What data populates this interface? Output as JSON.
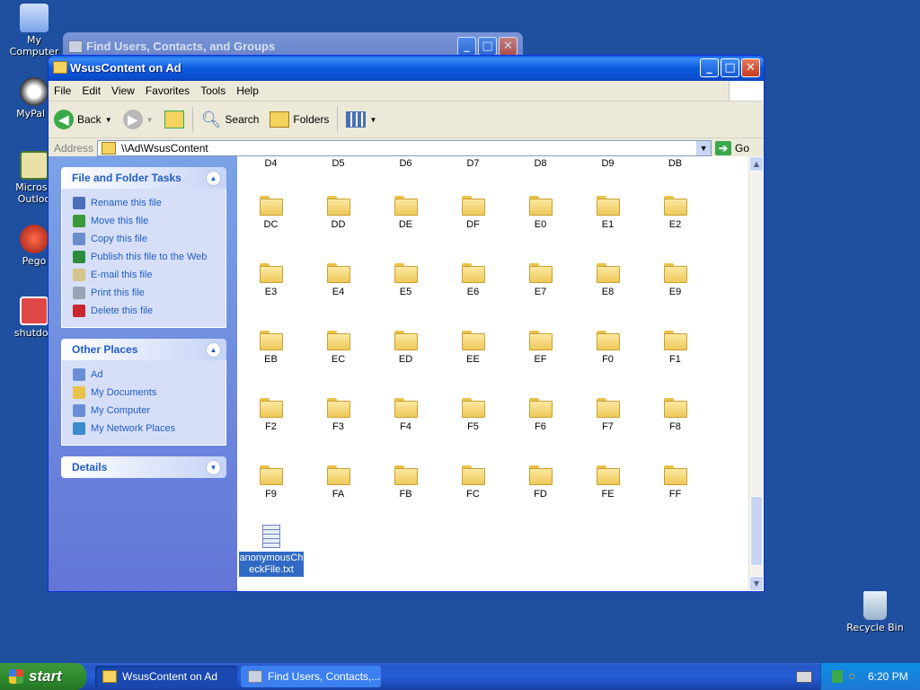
{
  "desktop": {
    "icons": [
      {
        "label": "My Computer"
      },
      {
        "label": "MyPal t"
      },
      {
        "label": "Microsc Outloo"
      },
      {
        "label": "Pego"
      },
      {
        "label": "shutdov"
      },
      {
        "label": "Recycle Bin"
      }
    ]
  },
  "background_window": {
    "title": "Find Users, Contacts, and Groups"
  },
  "window": {
    "title": "WsusContent on Ad",
    "controls": {
      "minimize": "_",
      "maximize": "□",
      "close": "✕"
    }
  },
  "menu": [
    "File",
    "Edit",
    "View",
    "Favorites",
    "Tools",
    "Help"
  ],
  "toolbar": {
    "back": "Back",
    "search": "Search",
    "folders": "Folders"
  },
  "address": {
    "label": "Address",
    "value": "\\\\Ad\\WsusContent",
    "go": "Go"
  },
  "tasks": {
    "file_folder": {
      "title": "File and Folder Tasks",
      "items": [
        {
          "label": "Rename this file",
          "icon": "rename-icon",
          "color": "#4a6fb5"
        },
        {
          "label": "Move this file",
          "icon": "move-icon",
          "color": "#3a9a3a"
        },
        {
          "label": "Copy this file",
          "icon": "copy-icon",
          "color": "#6c8ccd"
        },
        {
          "label": "Publish this file to the Web",
          "icon": "globe-icon",
          "color": "#2c8c3e"
        },
        {
          "label": "E-mail this file",
          "icon": "email-icon",
          "color": "#d4c48a"
        },
        {
          "label": "Print this file",
          "icon": "print-icon",
          "color": "#9aa4b4"
        },
        {
          "label": "Delete this file",
          "icon": "delete-icon",
          "color": "#c8282e"
        }
      ]
    },
    "other_places": {
      "title": "Other Places",
      "items": [
        {
          "label": "Ad",
          "icon": "computer-icon",
          "color": "#6a8ed6"
        },
        {
          "label": "My Documents",
          "icon": "documents-folder-icon",
          "color": "#e9c24a"
        },
        {
          "label": "My Computer",
          "icon": "computer-icon",
          "color": "#6a8ed6"
        },
        {
          "label": "My Network Places",
          "icon": "network-icon",
          "color": "#3a8ccf"
        }
      ]
    },
    "details": {
      "title": "Details"
    }
  },
  "folders": {
    "top_row": [
      "D4",
      "D5",
      "D6",
      "D7",
      "D8",
      "D9",
      "DB"
    ],
    "rows": [
      [
        "DC",
        "DD",
        "DE",
        "DF",
        "E0",
        "E1",
        "E2"
      ],
      [
        "E3",
        "E4",
        "E5",
        "E6",
        "E7",
        "E8",
        "E9"
      ],
      [
        "EB",
        "EC",
        "ED",
        "EE",
        "EF",
        "F0",
        "F1"
      ],
      [
        "F2",
        "F3",
        "F4",
        "F5",
        "F6",
        "F7",
        "F8"
      ],
      [
        "F9",
        "FA",
        "FB",
        "FC",
        "FD",
        "FE",
        "FF"
      ]
    ]
  },
  "selected_file": {
    "name": "anonymousCheckFile.txt"
  },
  "taskbar": {
    "start": "start",
    "tasks": [
      {
        "label": "WsusContent on Ad"
      },
      {
        "label": "Find Users, Contacts,..."
      }
    ],
    "clock": "6:20 PM"
  }
}
